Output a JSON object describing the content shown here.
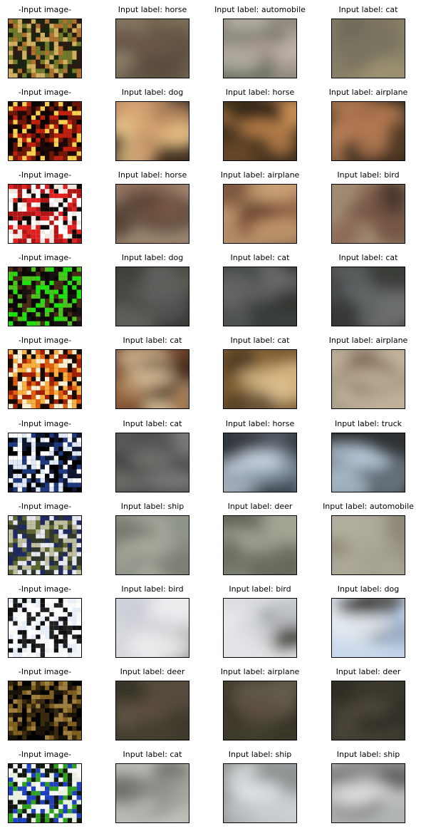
{
  "colors": {
    "background": "#ffffff",
    "frame": "#000000",
    "text": "#000000"
  },
  "rows": [
    {
      "cells": [
        {
          "title": "-Input image-",
          "kind": "input",
          "palette": [
            "#2c1b12",
            "#6f7a2a",
            "#b07030",
            "#192411",
            "#d0b060"
          ]
        },
        {
          "title": "Input label: horse",
          "kind": "recon",
          "palette": [
            "#7d7058",
            "#6d5848",
            "#8c8068",
            "#5a4c3c",
            "#9a8a72"
          ]
        },
        {
          "title": "Input label: automobile",
          "kind": "recon",
          "palette": [
            "#8a8878",
            "#ad9c94",
            "#5e6a58",
            "#7e8070",
            "#c0b8b0"
          ]
        },
        {
          "title": "Input label: cat",
          "kind": "recon",
          "palette": [
            "#8c8468",
            "#7d7660",
            "#a09474",
            "#6e6858",
            "#95896e"
          ]
        }
      ]
    },
    {
      "cells": [
        {
          "title": "-Input image-",
          "kind": "input",
          "palette": [
            "#0a0403",
            "#c02010",
            "#f8d050",
            "#701808",
            "#200806"
          ]
        },
        {
          "title": "Input label: dog",
          "kind": "recon",
          "palette": [
            "#3e2c1c",
            "#d8a070",
            "#7a5030",
            "#f0cc90",
            "#2a1e14"
          ]
        },
        {
          "title": "Input label: horse",
          "kind": "recon",
          "palette": [
            "#3a2c1a",
            "#c88a50",
            "#6e4a2a",
            "#e0a060",
            "#2a2014"
          ]
        },
        {
          "title": "Input label: airplane",
          "kind": "recon",
          "palette": [
            "#342818",
            "#b47850",
            "#5e4028",
            "#c88c60",
            "#281e14"
          ]
        }
      ]
    },
    {
      "cells": [
        {
          "title": "-Input image-",
          "kind": "input",
          "palette": [
            "#ffffff",
            "#e02020",
            "#100808",
            "#b01414",
            "#f0e8e0"
          ]
        },
        {
          "title": "Input label: horse",
          "kind": "recon",
          "palette": [
            "#9a8470",
            "#6e5040",
            "#b89a80",
            "#4a3a2e",
            "#8a6450"
          ]
        },
        {
          "title": "Input label: airplane",
          "kind": "recon",
          "palette": [
            "#b48c68",
            "#6a4430",
            "#2e2218",
            "#d0a878",
            "#8e5a40"
          ]
        },
        {
          "title": "Input label: bird",
          "kind": "recon",
          "palette": [
            "#a08a70",
            "#6e5040",
            "#3a2c22",
            "#c8b092",
            "#8a6652"
          ]
        }
      ]
    },
    {
      "cells": [
        {
          "title": "-Input image-",
          "kind": "input",
          "palette": [
            "#0a0806",
            "#50c020",
            "#4a2a18",
            "#20e010",
            "#1a1210"
          ]
        },
        {
          "title": "Input label: dog",
          "kind": "recon",
          "palette": [
            "#3c4038",
            "#5e605c",
            "#2a2e28",
            "#6a6864",
            "#464a42"
          ]
        },
        {
          "title": "Input label: cat",
          "kind": "recon",
          "palette": [
            "#30342e",
            "#5a5e5c",
            "#24282a",
            "#6c6e6e",
            "#3e4440"
          ]
        },
        {
          "title": "Input label: cat",
          "kind": "recon",
          "palette": [
            "#3a3e38",
            "#64686a",
            "#2c302c",
            "#767878",
            "#464a44"
          ]
        }
      ]
    },
    {
      "cells": [
        {
          "title": "-Input image-",
          "kind": "input",
          "palette": [
            "#1a0a04",
            "#f8f0d0",
            "#e06010",
            "#a02008",
            "#f8b040"
          ]
        },
        {
          "title": "Input label: cat",
          "kind": "recon",
          "palette": [
            "#6a4028",
            "#e0c8a0",
            "#9a6a40",
            "#3a2416",
            "#c09a70"
          ]
        },
        {
          "title": "Input label: cat",
          "kind": "recon",
          "palette": [
            "#7a5a30",
            "#d4b480",
            "#a07a48",
            "#4a3820",
            "#e0c494"
          ]
        },
        {
          "title": "Input label: airplane",
          "kind": "recon",
          "palette": [
            "#a89c88",
            "#c8b8a0",
            "#7e6654",
            "#5a4e44",
            "#b0a48e"
          ]
        }
      ]
    },
    {
      "cells": [
        {
          "title": "-Input image-",
          "kind": "input",
          "palette": [
            "#000000",
            "#ffffff",
            "#203a80",
            "#e0e8f8",
            "#101830"
          ]
        },
        {
          "title": "Input label: cat",
          "kind": "recon",
          "palette": [
            "#4a4c4a",
            "#7a7874",
            "#3a3c3a",
            "#8a8886",
            "#5a5a58"
          ]
        },
        {
          "title": "Input label: horse",
          "kind": "recon",
          "palette": [
            "#3a4048",
            "#d0dce8",
            "#5a6068",
            "#8090a0",
            "#2e3238"
          ]
        },
        {
          "title": "Input label: truck",
          "kind": "recon",
          "palette": [
            "#2e3234",
            "#c0d4e4",
            "#505860",
            "#7a8490",
            "#262a2c"
          ]
        }
      ]
    },
    {
      "cells": [
        {
          "title": "-Input image-",
          "kind": "input",
          "palette": [
            "#202a60",
            "#c0c0a0",
            "#606a30",
            "#e8e8f0",
            "#30382a"
          ]
        },
        {
          "title": "Input label: ship",
          "kind": "recon",
          "palette": [
            "#8e9488",
            "#a8aa9e",
            "#6c7064",
            "#b6b6aa",
            "#7c8074"
          ]
        },
        {
          "title": "Input label: deer",
          "kind": "recon",
          "palette": [
            "#7e8474",
            "#9ea290",
            "#5a5e50",
            "#b0b4a2",
            "#6e7264"
          ]
        },
        {
          "title": "Input label: automobile",
          "kind": "recon",
          "palette": [
            "#9a9684",
            "#aeaa98",
            "#8a8470",
            "#b4b0a0",
            "#928c7a"
          ]
        }
      ]
    },
    {
      "cells": [
        {
          "title": "-Input image-",
          "kind": "input",
          "palette": [
            "#ffffff",
            "#101010",
            "#f8f8f8",
            "#202020",
            "#e8eef8"
          ]
        },
        {
          "title": "Input label: bird",
          "kind": "recon",
          "palette": [
            "#e4e6ea",
            "#d0d2d8",
            "#3e3c30",
            "#f0f0f2",
            "#c8ccd4"
          ]
        },
        {
          "title": "Input label: bird",
          "kind": "recon",
          "palette": [
            "#dcdee2",
            "#ced2d8",
            "#3a382c",
            "#eaeaec",
            "#c4c8ce"
          ]
        },
        {
          "title": "Input label: dog",
          "kind": "recon",
          "palette": [
            "#c8d8ec",
            "#e6ecf2",
            "#302e28",
            "#a8c0dc",
            "#dfe6ee"
          ]
        }
      ]
    },
    {
      "cells": [
        {
          "title": "-Input image-",
          "kind": "input",
          "palette": [
            "#000000",
            "#3a2a10",
            "#806020",
            "#1a1408",
            "#a08040"
          ]
        },
        {
          "title": "Input label: deer",
          "kind": "recon",
          "palette": [
            "#3e3a2c",
            "#5e5040",
            "#2e2c22",
            "#6a5c4a",
            "#464030"
          ]
        },
        {
          "title": "Input label: airplane",
          "kind": "recon",
          "palette": [
            "#3a3828",
            "#5a4e3e",
            "#2c2a20",
            "#686050",
            "#44402e"
          ]
        },
        {
          "title": "Input label: deer",
          "kind": "recon",
          "palette": [
            "#34322a",
            "#504a3c",
            "#2a2820",
            "#5c5444",
            "#3c3a2e"
          ]
        }
      ]
    },
    {
      "cells": [
        {
          "title": "-Input image-",
          "kind": "input",
          "palette": [
            "#e8f0e0",
            "#30a020",
            "#2040c0",
            "#101810",
            "#f8f8f8"
          ]
        },
        {
          "title": "Input label: cat",
          "kind": "recon",
          "palette": [
            "#b8bab4",
            "#8a8882",
            "#d4d6d0",
            "#5a5a54",
            "#a2a29c"
          ]
        },
        {
          "title": "Input label: ship",
          "kind": "recon",
          "palette": [
            "#a8aeb0",
            "#e4e8ea",
            "#5e6262",
            "#c8ccce",
            "#868a8a"
          ]
        },
        {
          "title": "Input label: ship",
          "kind": "recon",
          "palette": [
            "#b0b4b4",
            "#dcdedc",
            "#464848",
            "#c4c6c4",
            "#8a8c8c"
          ]
        }
      ]
    }
  ]
}
